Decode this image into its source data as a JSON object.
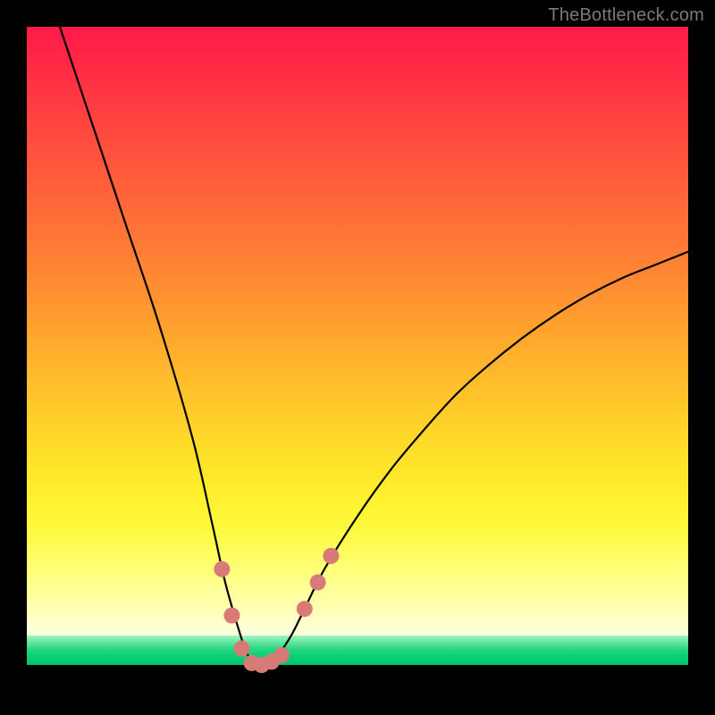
{
  "watermark": "TheBottleneck.com",
  "chart_data": {
    "type": "line",
    "title": "",
    "xlabel": "",
    "ylabel": "",
    "xlim": [
      0,
      100
    ],
    "ylim": [
      0,
      100
    ],
    "grid": false,
    "legend": false,
    "series": [
      {
        "name": "bottleneck-curve",
        "x": [
          5,
          10,
          15,
          20,
          25,
          28,
          30,
          32,
          33,
          34,
          35,
          36,
          37,
          38,
          40,
          42,
          45,
          50,
          55,
          60,
          65,
          70,
          75,
          80,
          85,
          90,
          95,
          100
        ],
        "y": [
          100,
          85,
          70,
          55,
          38,
          25,
          16,
          9,
          6,
          4,
          3.5,
          3.5,
          4,
          5,
          8,
          12,
          18,
          26,
          33,
          39,
          44.5,
          49,
          53,
          56.5,
          59.5,
          62,
          64,
          66
        ]
      }
    ],
    "markers": [
      {
        "name": "highlight-left-upper",
        "x": 29.5,
        "y": 18
      },
      {
        "name": "highlight-left-mid",
        "x": 31.0,
        "y": 11
      },
      {
        "name": "highlight-left-lower",
        "x": 32.5,
        "y": 6
      },
      {
        "name": "highlight-valley-1",
        "x": 34.0,
        "y": 3.8
      },
      {
        "name": "highlight-valley-2",
        "x": 35.5,
        "y": 3.5
      },
      {
        "name": "highlight-valley-3",
        "x": 37.0,
        "y": 4.0
      },
      {
        "name": "highlight-valley-4",
        "x": 38.5,
        "y": 5.0
      },
      {
        "name": "highlight-right-lower",
        "x": 42.0,
        "y": 12
      },
      {
        "name": "highlight-right-mid",
        "x": 44.0,
        "y": 16
      },
      {
        "name": "highlight-right-upper",
        "x": 46.0,
        "y": 20
      }
    ],
    "marker_style": {
      "color": "#d87a78",
      "radius_px": 9
    },
    "gradient_stops": [
      {
        "pos": 0.0,
        "color": "#ff1a49"
      },
      {
        "pos": 0.3,
        "color": "#ff7237"
      },
      {
        "pos": 0.55,
        "color": "#ffc72b"
      },
      {
        "pos": 0.75,
        "color": "#fff93e"
      },
      {
        "pos": 0.9,
        "color": "#ffffd0"
      },
      {
        "pos": 0.945,
        "color": "#23d67e"
      },
      {
        "pos": 0.965,
        "color": "#000000"
      }
    ]
  }
}
